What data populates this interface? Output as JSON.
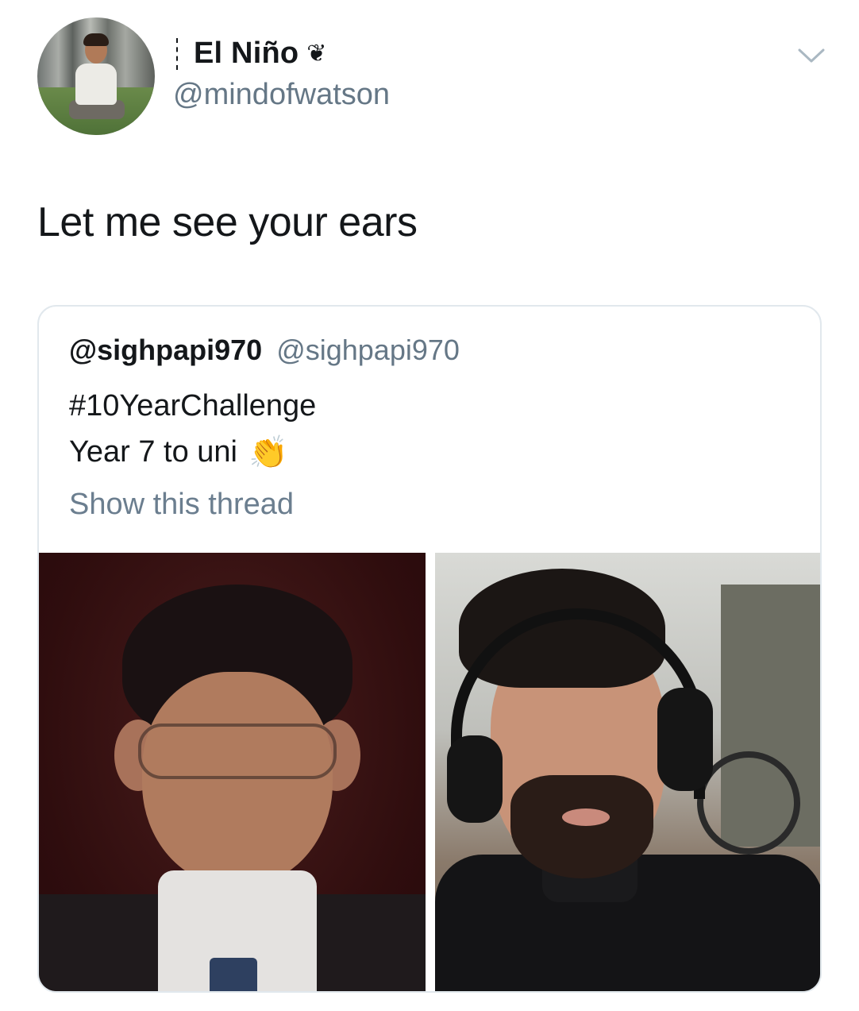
{
  "header": {
    "display_name": "El Niño",
    "name_emoji": "❦",
    "handle": "@mindofwatson"
  },
  "tweet": {
    "text": "Let me see your ears"
  },
  "quoted_tweet": {
    "display_name": "@sighpapi970",
    "handle": "@sighpapi970",
    "line1": "#10YearChallenge",
    "line2": "Year 7 to uni",
    "line2_emoji": "👏",
    "show_thread": "Show this thread"
  },
  "colors": {
    "text": "#14171a",
    "secondary": "#657786",
    "border": "#e1e8ed"
  },
  "icons": {
    "menu": "chevron-down-icon",
    "clap": "clapping-hands-icon"
  }
}
